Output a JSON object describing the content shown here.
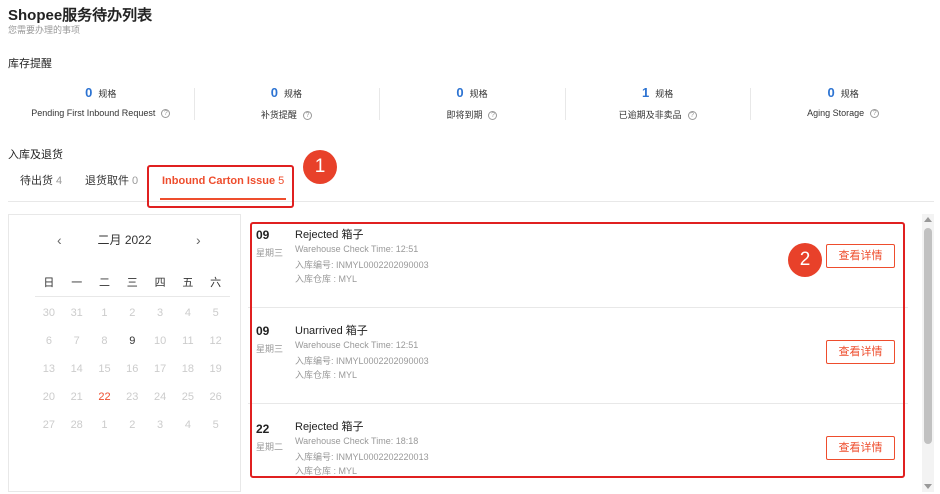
{
  "page": {
    "title": "Shopee服务待办列表",
    "subtitle": "您需要办理的事项"
  },
  "inventory": {
    "heading": "库存提醒",
    "unit": "规格",
    "stats": [
      {
        "count": "0",
        "label": "Pending First Inbound Request"
      },
      {
        "count": "0",
        "label": "补货提醒"
      },
      {
        "count": "0",
        "label": "即将到期"
      },
      {
        "count": "1",
        "label": "已逾期及非卖品"
      },
      {
        "count": "0",
        "label": "Aging Storage"
      }
    ]
  },
  "inbound": {
    "heading": "入库及退货",
    "tabs": [
      {
        "label": "待出货",
        "count": "4"
      },
      {
        "label": "退货取件",
        "count": "0"
      },
      {
        "label": "Inbound Carton Issue",
        "count": "5"
      }
    ]
  },
  "annotations": {
    "badge1": "1",
    "badge2": "2"
  },
  "calendar": {
    "month": "二月 2022",
    "prev": "‹",
    "next": "›",
    "weekdays": [
      "日",
      "一",
      "二",
      "三",
      "四",
      "五",
      "六"
    ],
    "weeks": [
      [
        "30",
        "31",
        "1",
        "2",
        "3",
        "4",
        "5"
      ],
      [
        "6",
        "7",
        "8",
        "9",
        "10",
        "11",
        "12"
      ],
      [
        "13",
        "14",
        "15",
        "16",
        "17",
        "18",
        "19"
      ],
      [
        "20",
        "21",
        "22",
        "23",
        "24",
        "25",
        "26"
      ],
      [
        "27",
        "28",
        "1",
        "2",
        "3",
        "4",
        "5"
      ]
    ]
  },
  "issues": [
    {
      "day": "09",
      "weekday": "星期三",
      "title": "Rejected 箱子",
      "check_time": "Warehouse Check Time: 12:51",
      "inbound_no": "入库编号: INMYL0002202090003",
      "warehouse": "入库仓库 : MYL",
      "button": "查看详情"
    },
    {
      "day": "09",
      "weekday": "星期三",
      "title": "Unarrived 箱子",
      "check_time": "Warehouse Check Time: 12:51",
      "inbound_no": "入库编号: INMYL0002202090003",
      "warehouse": "入库仓库 : MYL",
      "button": "查看详情"
    },
    {
      "day": "22",
      "weekday": "星期二",
      "title": "Rejected 箱子",
      "check_time": "Warehouse Check Time: 18:18",
      "inbound_no": "入库编号: INMYL0002202220013",
      "warehouse": "入库仓库 : MYL",
      "button": "查看详情"
    }
  ],
  "colors": {
    "accent": "#ee4d2d",
    "link_blue": "#2c73d2",
    "annotation_red": "#e02020"
  }
}
